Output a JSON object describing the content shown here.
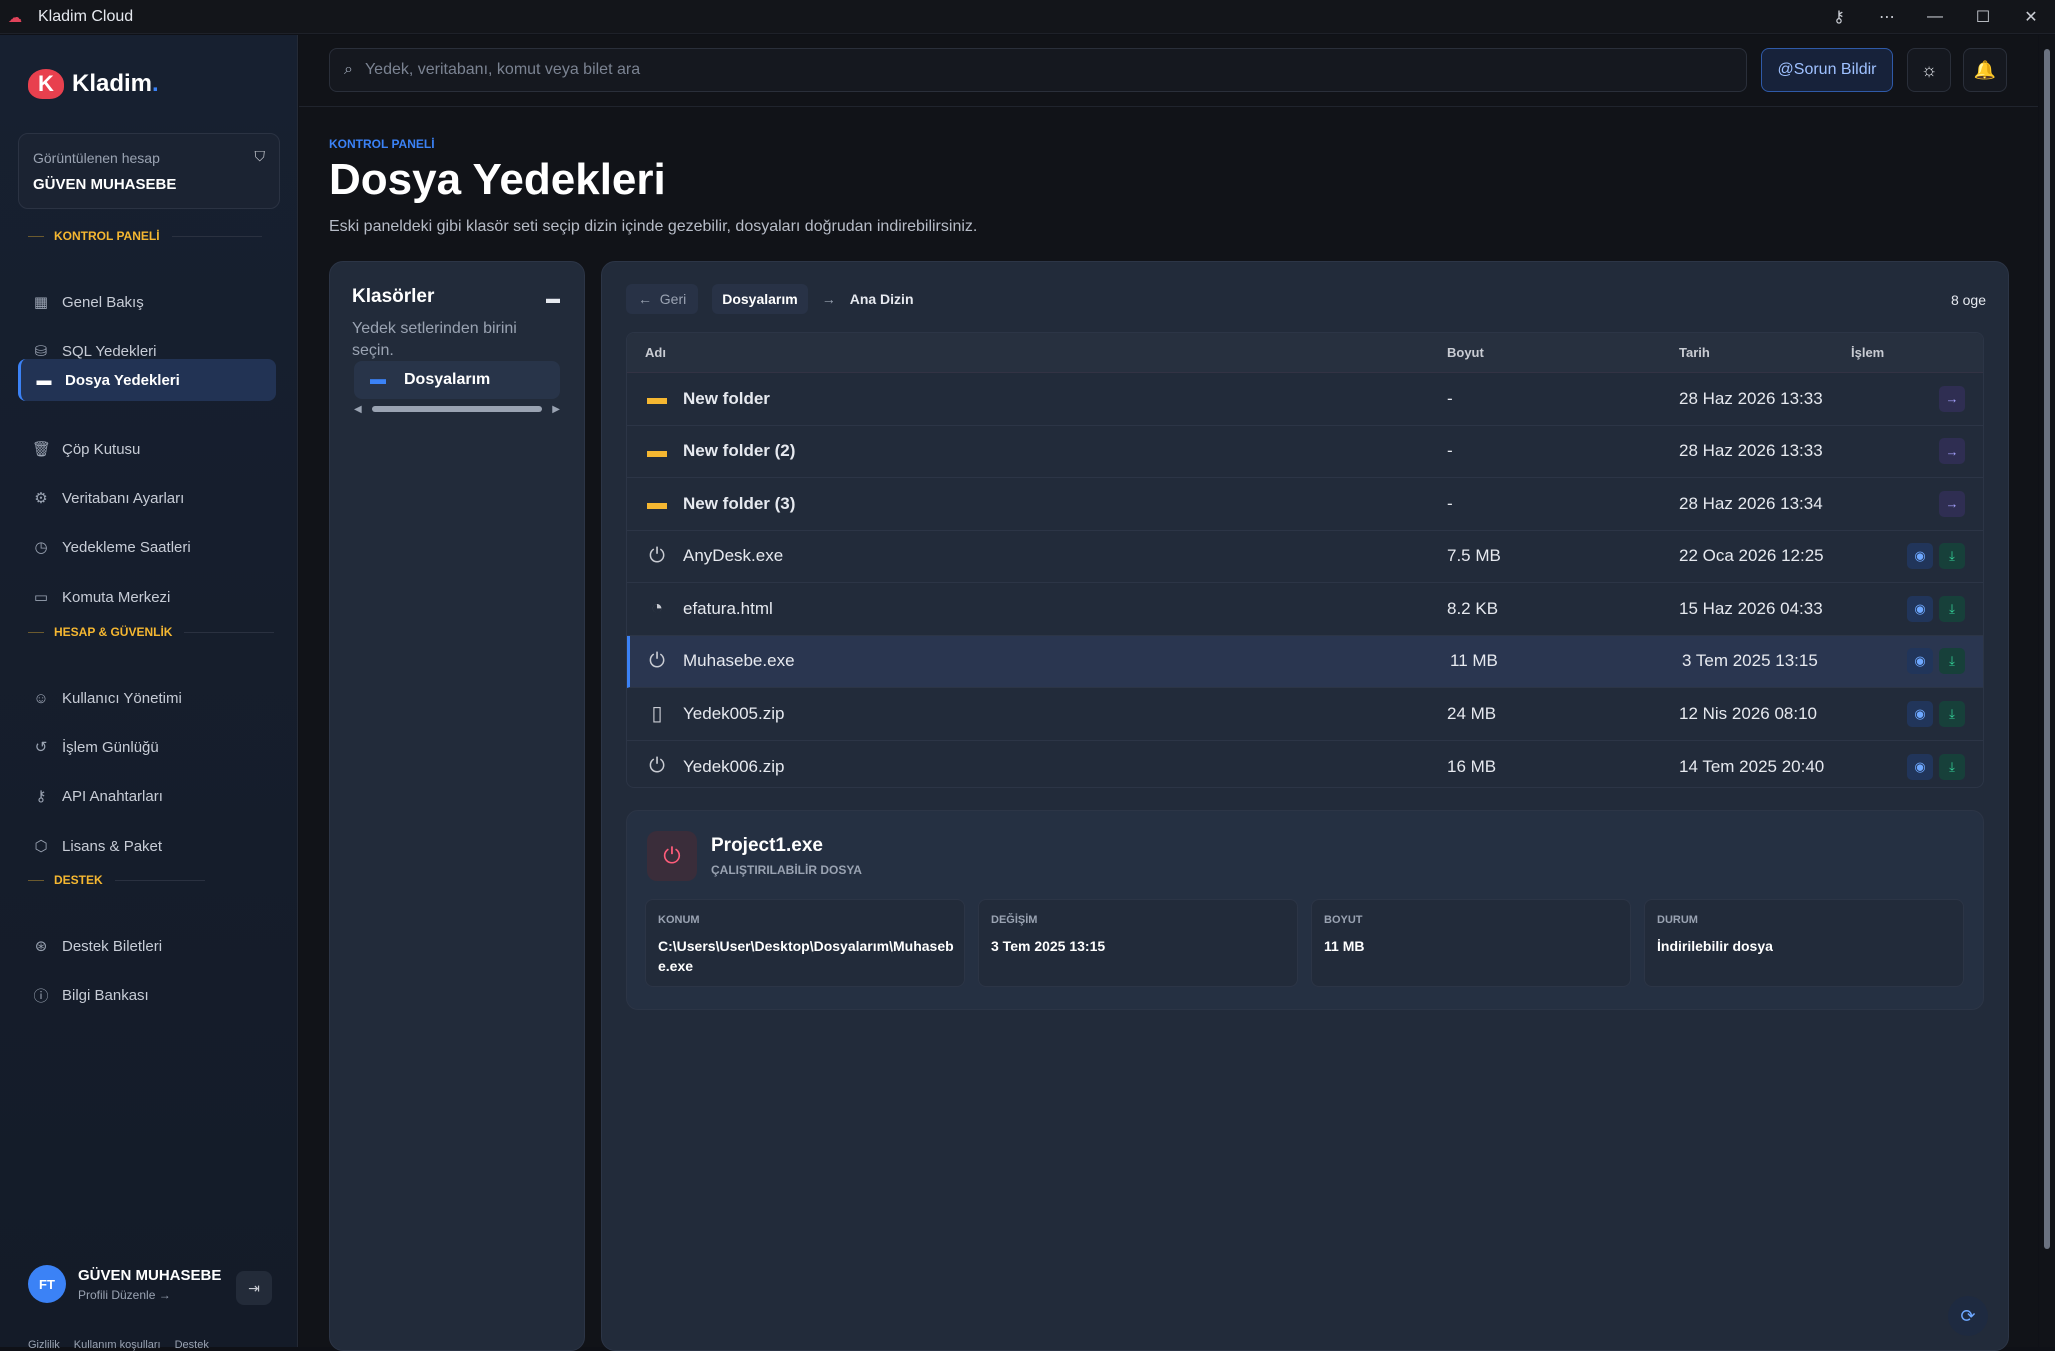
{
  "window": {
    "title": "Kladim Cloud"
  },
  "brand": {
    "name": "Kladim",
    "dot": ".",
    "mark": "K"
  },
  "account": {
    "label": "Görüntülenen hesap",
    "name": "GÜVEN MUHASEBE"
  },
  "sections": {
    "panel": "KONTROL PANELİ",
    "security": "HESAP & GÜVENLİK",
    "support": "DESTEK"
  },
  "nav": {
    "overview": "Genel Bakış",
    "sql": "SQL Yedekleri",
    "files": "Dosya Yedekleri",
    "trash": "Çöp Kutusu",
    "db_settings": "Veritabanı Ayarları",
    "schedule": "Yedekleme Saatleri",
    "command": "Komuta Merkezi",
    "users": "Kullanıcı Yönetimi",
    "log": "İşlem Günlüğü",
    "api": "API Anahtarları",
    "license": "Lisans & Paket",
    "tickets": "Destek Biletleri",
    "kb": "Bilgi Bankası"
  },
  "user": {
    "initials": "FT",
    "name": "GÜVEN MUHASEBE",
    "edit": "Profili Düzenle →"
  },
  "footer": {
    "privacy": "Gizlilik",
    "terms": "Kullanım koşulları",
    "support": "Destek"
  },
  "topbar": {
    "search_placeholder": "Yedek, veritabanı, komut veya bilet ara",
    "report": "Sorun Bildir"
  },
  "page": {
    "crumb": "KONTROL PANELİ",
    "title": "Dosya Yedekleri",
    "subtitle": "Eski paneldeki gibi klasör seti seçip dizin içinde gezebilir, dosyaları doğrudan indirebilirsiniz."
  },
  "folders": {
    "title": "Klasörler",
    "desc": "Yedek setlerinden birini seçin.",
    "items": [
      "Dosyalarım"
    ]
  },
  "browser": {
    "back": "Geri",
    "current": "Dosyalarım",
    "root": "Ana Dizin",
    "count": "8 oge",
    "columns": {
      "name": "Adı",
      "size": "Boyut",
      "date": "Tarih",
      "action": "İşlem"
    },
    "rows": [
      {
        "name": "New folder",
        "size": "-",
        "date": "28 Haz 2026 13:33"
      },
      {
        "name": "New folder (2)",
        "size": "-",
        "date": "28 Haz 2026 13:33"
      },
      {
        "name": "New folder (3)",
        "size": "-",
        "date": "28 Haz 2026 13:34"
      },
      {
        "name": "AnyDesk.exe",
        "size": "7.5 MB",
        "date": "22 Oca 2026 12:25"
      },
      {
        "name": "efatura.html",
        "size": "8.2 KB",
        "date": "15 Haz 2026 04:33"
      },
      {
        "name": "Muhasebe.exe",
        "size": "11 MB",
        "date": "3 Tem 2025 13:15"
      },
      {
        "name": "Yedek005.zip",
        "size": "24 MB",
        "date": "12 Nis 2026 08:10"
      },
      {
        "name": "Yedek006.zip",
        "size": "16 MB",
        "date": "14 Tem 2025 20:40"
      }
    ]
  },
  "detail": {
    "name": "Project1.exe",
    "type": "ÇALIŞTIRILABİLİR DOSYA",
    "location_label": "KONUM",
    "location": "C:\\Users\\User\\Desktop\\Dosyalarım\\Muhasebe.exe",
    "modified_label": "DEĞİŞİM",
    "modified": "3 Tem 2025 13:15",
    "size_label": "BOYUT",
    "size": "11 MB",
    "status_label": "DURUM",
    "status": "İndirilebilir dosya"
  }
}
